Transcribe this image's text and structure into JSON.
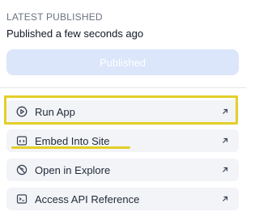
{
  "publish": {
    "section_label": "LATEST PUBLISHED",
    "status_text": "Published a few seconds ago",
    "button_label": "Published",
    "button_color": "#dbe6fb"
  },
  "actions": [
    {
      "label": "Run App",
      "icon": "play-circle-icon"
    },
    {
      "label": "Embed Into Site",
      "icon": "embed-window-icon"
    },
    {
      "label": "Open in Explore",
      "icon": "explore-icon"
    },
    {
      "label": "Access API Reference",
      "icon": "terminal-icon"
    }
  ],
  "annotations": {
    "highlight_color": "#e3cf2a"
  }
}
